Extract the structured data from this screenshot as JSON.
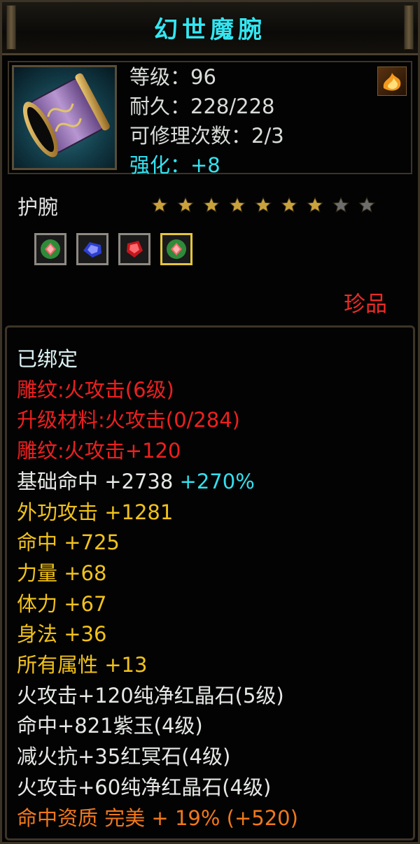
{
  "title": "幻世魔腕",
  "header": {
    "icon": "bracer-icon",
    "stats": [
      {
        "text": "等级：96",
        "color": "white"
      },
      {
        "text": "耐久：228/228",
        "color": "white"
      },
      {
        "text": "可修理次数：2/3",
        "color": "white"
      },
      {
        "text": "强化：+8",
        "color": "cyan"
      }
    ],
    "corner_icon": "flame-icon"
  },
  "item": {
    "type": "护腕",
    "stars": {
      "filled": 7,
      "total": 9
    },
    "gems": [
      {
        "icon": "green-red-gem-icon",
        "selected": false
      },
      {
        "icon": "blue-gem-icon",
        "selected": false
      },
      {
        "icon": "red-crystal-icon",
        "selected": false
      },
      {
        "icon": "green-red-gem-icon",
        "selected": true
      }
    ],
    "rarity": "珍品"
  },
  "attributes": {
    "bound": "已绑定",
    "engrave": "雕纹:火攻击(6级)",
    "upgrade_material": "升级材料:火攻击(0/284)",
    "engrave_bonus": "雕纹:火攻击+120",
    "base_hit": "基础命中 +2738",
    "base_hit_pct": " +270%",
    "external_attack": "外功攻击 +1281",
    "hit": "命中 +725",
    "strength": "力量 +68",
    "stamina": "体力 +67",
    "agility": "身法 +36",
    "all_attributes": "所有属性 +13",
    "gem_lines": [
      "火攻击+120纯净红晶石(5级)",
      "命中+821紫玉(4级)",
      "减火抗+35红冥石(4级)",
      "火攻击+60纯净红晶石(4级)"
    ],
    "aptitude": "命中资质 完美 + 19% (+520)"
  },
  "colors": {
    "title": "#34e6f1",
    "enhance": "#33e4f0",
    "rarity": "#ec2a26",
    "engrave": "#ee1f1f",
    "attribute": "#f0c21b",
    "aptitude": "#f0781b",
    "star_filled": "#c9a23c",
    "star_empty": "#6d6d6d"
  }
}
